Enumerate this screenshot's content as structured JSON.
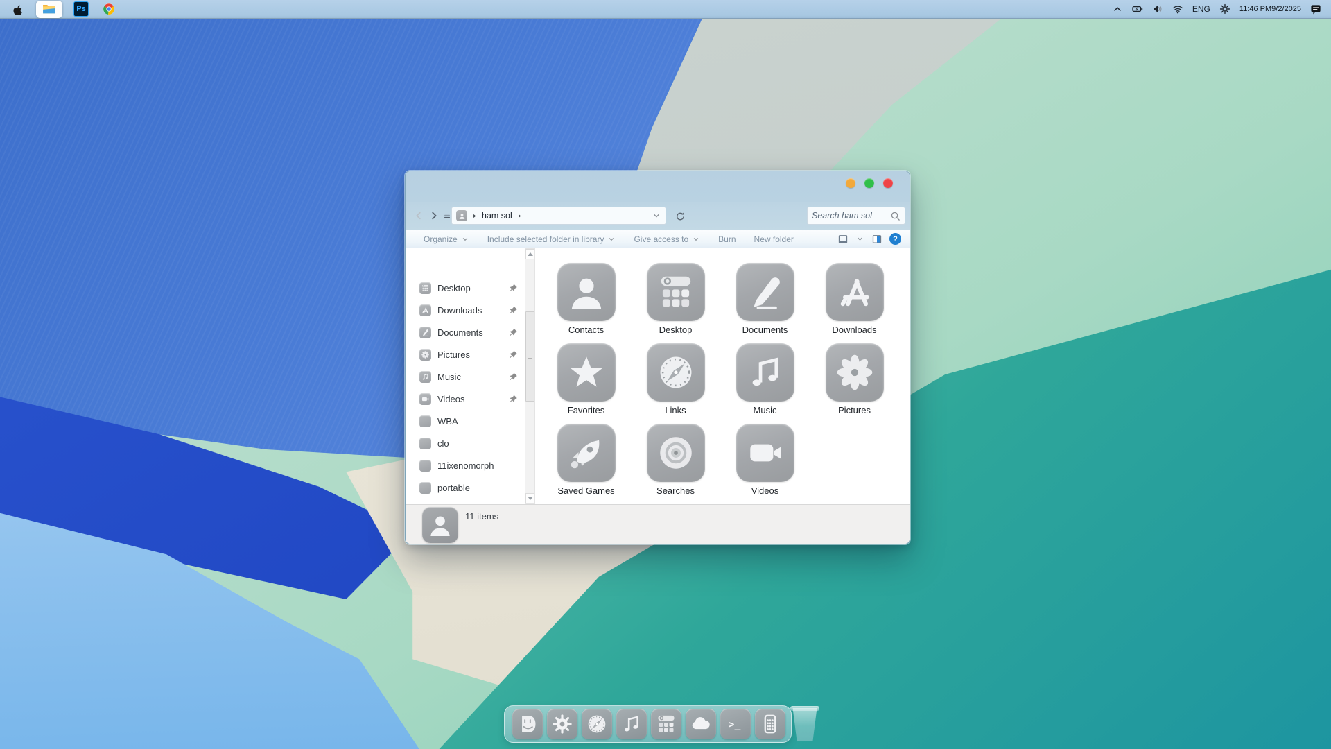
{
  "colors": {
    "traffic_minimize": "#f2a93b",
    "traffic_zoom": "#2fbf49",
    "traffic_close": "#ef4347",
    "help_accent": "#1f7fd0",
    "preview_accent": "#2f86d6",
    "menubar_tint": "#a8c8e2",
    "tile_gray": "#a4a7ab"
  },
  "menubar": {
    "apps": [
      {
        "name": "apple-menu",
        "icon": "apple"
      },
      {
        "name": "file-explorer",
        "icon": "explorer",
        "active": true
      },
      {
        "name": "photoshop",
        "icon": "photoshop",
        "label": "Ps"
      },
      {
        "name": "chrome",
        "icon": "chrome"
      }
    ],
    "tray": {
      "language": "ENG",
      "time": "11:46 PM",
      "date": "9/2/2025"
    }
  },
  "window": {
    "traffic_lights": [
      {
        "name": "minimize",
        "color": "#f2a93b"
      },
      {
        "name": "zoom",
        "color": "#2fbf49"
      },
      {
        "name": "close",
        "color": "#ef4347"
      }
    ],
    "nav": {
      "breadcrumb": "ham sol",
      "search_placeholder": "Search ham sol"
    },
    "toolbar": {
      "buttons": [
        {
          "label": "Organize",
          "menu": true
        },
        {
          "label": "Include selected folder in library",
          "menu": true
        },
        {
          "label": "Give access to",
          "menu": true
        },
        {
          "label": "Burn",
          "menu": false
        },
        {
          "label": "New folder",
          "menu": false
        }
      ],
      "help_label": "?"
    },
    "sidebar": {
      "items": [
        {
          "label": "Desktop",
          "icon": "launchpad",
          "pinned": true
        },
        {
          "label": "Downloads",
          "icon": "appstore",
          "pinned": true
        },
        {
          "label": "Documents",
          "icon": "pen",
          "pinned": true
        },
        {
          "label": "Pictures",
          "icon": "flower",
          "pinned": true
        },
        {
          "label": "Music",
          "icon": "note",
          "pinned": true
        },
        {
          "label": "Videos",
          "icon": "camera",
          "pinned": true
        },
        {
          "label": "WBA",
          "icon": "folder",
          "pinned": false
        },
        {
          "label": "clo",
          "icon": "folder",
          "pinned": false
        },
        {
          "label": "11ixenomorph",
          "icon": "folder",
          "pinned": false
        },
        {
          "label": "portable",
          "icon": "folder",
          "pinned": false
        }
      ]
    },
    "files": [
      {
        "label": "Contacts",
        "icon": "person"
      },
      {
        "label": "Desktop",
        "icon": "launchpad"
      },
      {
        "label": "Documents",
        "icon": "pen"
      },
      {
        "label": "Downloads",
        "icon": "appstore"
      },
      {
        "label": "Favorites",
        "icon": "star"
      },
      {
        "label": "Links",
        "icon": "compass"
      },
      {
        "label": "Music",
        "icon": "note"
      },
      {
        "label": "Pictures",
        "icon": "flower"
      },
      {
        "label": "Saved Games",
        "icon": "rocket"
      },
      {
        "label": "Searches",
        "icon": "disc"
      },
      {
        "label": "Videos",
        "icon": "camera"
      }
    ],
    "status": {
      "items_text": "11 items"
    }
  },
  "dock": {
    "items": [
      {
        "name": "finder",
        "icon": "finder"
      },
      {
        "name": "system-preferences",
        "icon": "gear"
      },
      {
        "name": "safari",
        "icon": "compass"
      },
      {
        "name": "music",
        "icon": "note"
      },
      {
        "name": "launchpad",
        "icon": "launchpad"
      },
      {
        "name": "weather",
        "icon": "cloud"
      },
      {
        "name": "terminal",
        "icon": "terminal"
      },
      {
        "name": "device-keypad",
        "icon": "device"
      }
    ]
  }
}
